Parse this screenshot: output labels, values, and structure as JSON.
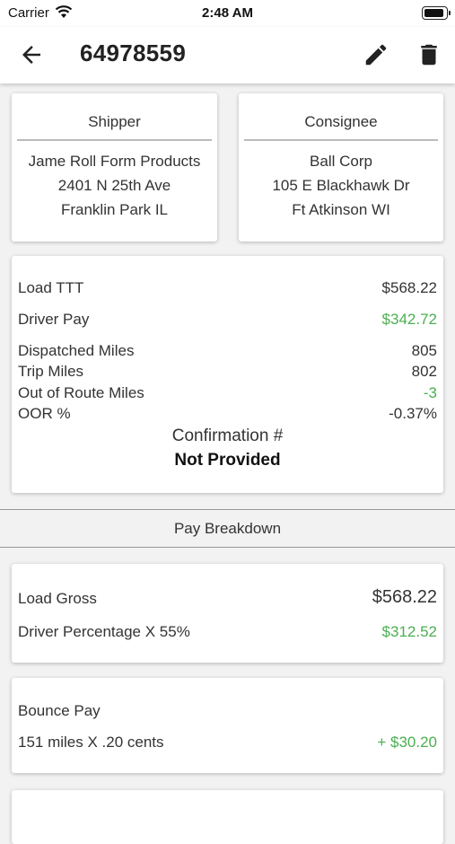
{
  "status_bar": {
    "carrier": "Carrier",
    "time": "2:48 AM"
  },
  "header": {
    "title": "64978559"
  },
  "shipper": {
    "heading": "Shipper",
    "name": "Jame Roll Form Products",
    "address": "2401 N 25th Ave",
    "city": "Franklin Park IL"
  },
  "consignee": {
    "heading": "Consignee",
    "name": "Ball Corp",
    "address": "105 E Blackhawk Dr",
    "city": "Ft Atkinson WI"
  },
  "summary": {
    "load_ttt_label": "Load TTT",
    "load_ttt_value": "$568.22",
    "driver_pay_label": "Driver Pay",
    "driver_pay_value": "$342.72",
    "dispatched_miles_label": "Dispatched Miles",
    "dispatched_miles_value": "805",
    "trip_miles_label": "Trip Miles",
    "trip_miles_value": "802",
    "out_of_route_label": "Out of Route Miles",
    "out_of_route_value": "-3",
    "oor_pct_label": "OOR %",
    "oor_pct_value": "-0.37%",
    "confirmation_label": "Confirmation #",
    "confirmation_value": "Not Provided"
  },
  "pay_breakdown": {
    "heading": "Pay Breakdown",
    "load_gross_label": "Load Gross",
    "load_gross_value": "$568.22",
    "driver_pct_label": "Driver Percentage X 55%",
    "driver_pct_value": "$312.52",
    "bounce_label": "Bounce Pay",
    "bounce_detail_label": "151 miles X .20 cents",
    "bounce_detail_value": "+ $30.20"
  },
  "colors": {
    "accent_green": "#4caf50",
    "text": "#333333",
    "background": "#f2f2f2"
  },
  "icons": {
    "back": "arrow-left-icon",
    "edit": "pencil-icon",
    "delete": "trash-icon"
  }
}
